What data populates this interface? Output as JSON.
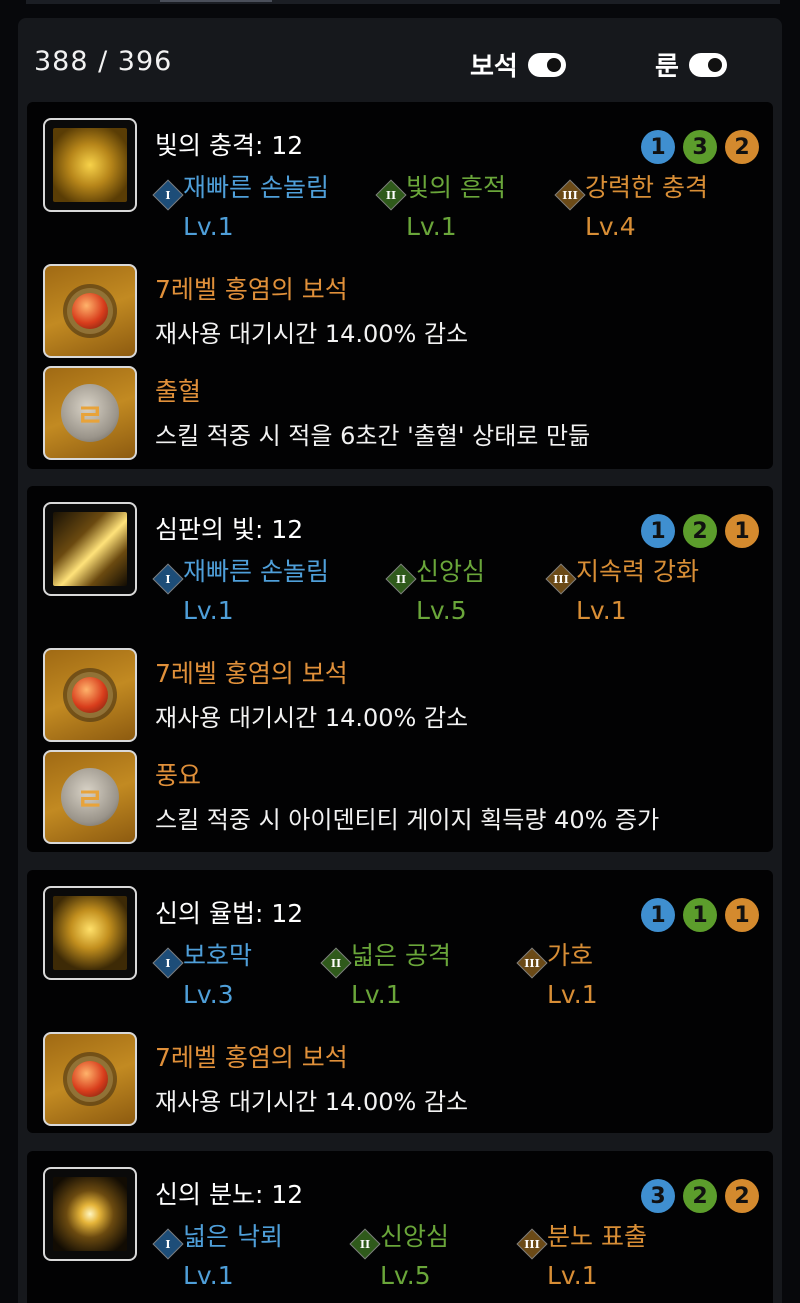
{
  "header": {
    "counter": "388 /  396",
    "gem_toggle_label": "보석",
    "rune_toggle_label": "룬"
  },
  "skills": [
    {
      "title": "빛의 충격: 12",
      "badges": [
        "1",
        "3",
        "2"
      ],
      "tripods": [
        {
          "roman": "I",
          "name": "재빠른 손놀림",
          "level": "Lv.1"
        },
        {
          "roman": "II",
          "name": "빛의 흔적",
          "level": "Lv.1"
        },
        {
          "roman": "III",
          "name": "강력한 충격",
          "level": "Lv.4"
        }
      ],
      "gem": {
        "name": "7레벨 홍염의 보석",
        "desc": "재사용 대기시간 14.00% 감소"
      },
      "rune": {
        "name": "출혈",
        "desc": "스킬 적중 시 적을 6초간 '출혈' 상태로 만듦"
      }
    },
    {
      "title": "심판의 빛: 12",
      "badges": [
        "1",
        "2",
        "1"
      ],
      "tripods": [
        {
          "roman": "I",
          "name": "재빠른 손놀림",
          "level": "Lv.1"
        },
        {
          "roman": "II",
          "name": "신앙심",
          "level": "Lv.5"
        },
        {
          "roman": "III",
          "name": "지속력 강화",
          "level": "Lv.1"
        }
      ],
      "gem": {
        "name": "7레벨 홍염의 보석",
        "desc": "재사용 대기시간 14.00% 감소"
      },
      "rune": {
        "name": "풍요",
        "desc": "스킬 적중 시 아이덴티티 게이지 획득량 40% 증가"
      }
    },
    {
      "title": "신의 율법: 12",
      "badges": [
        "1",
        "1",
        "1"
      ],
      "tripods": [
        {
          "roman": "I",
          "name": "보호막",
          "level": "Lv.3"
        },
        {
          "roman": "II",
          "name": "넓은 공격",
          "level": "Lv.1"
        },
        {
          "roman": "III",
          "name": "가호",
          "level": "Lv.1"
        }
      ],
      "gem": {
        "name": "7레벨 홍염의 보석",
        "desc": "재사용 대기시간 14.00% 감소"
      }
    },
    {
      "title": "신의 분노: 12",
      "badges": [
        "3",
        "2",
        "2"
      ],
      "tripods": [
        {
          "roman": "I",
          "name": "넓은 낙뢰",
          "level": "Lv.1"
        },
        {
          "roman": "II",
          "name": "신앙심",
          "level": "Lv.5"
        },
        {
          "roman": "III",
          "name": "분노 표출",
          "level": "Lv.1"
        }
      ]
    }
  ]
}
